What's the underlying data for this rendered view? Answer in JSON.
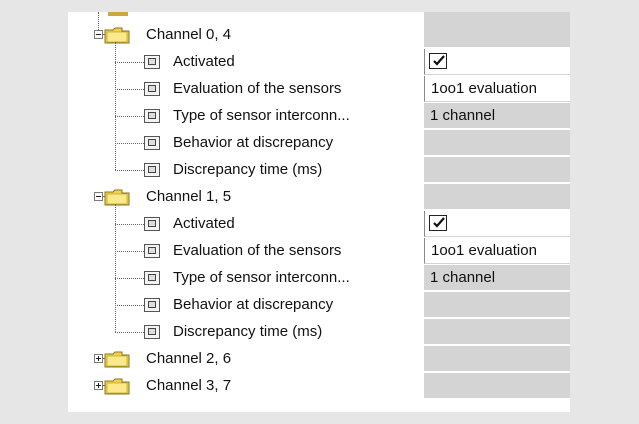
{
  "tree": {
    "channels": [
      {
        "label": "Channel 0, 4",
        "expanded": true,
        "params": [
          {
            "label": "Activated",
            "type": "checkbox",
            "checked": true
          },
          {
            "label": "Evaluation of the sensors",
            "type": "text",
            "value": "1oo1 evaluation"
          },
          {
            "label": "Type of sensor interconn...",
            "type": "text",
            "value": "1 channel"
          },
          {
            "label": "Behavior at discrepancy",
            "type": "empty"
          },
          {
            "label": "Discrepancy time (ms)",
            "type": "empty"
          }
        ]
      },
      {
        "label": "Channel 1, 5",
        "expanded": true,
        "params": [
          {
            "label": "Activated",
            "type": "checkbox",
            "checked": true
          },
          {
            "label": "Evaluation of the sensors",
            "type": "text",
            "value": "1oo1 evaluation"
          },
          {
            "label": "Type of sensor interconn...",
            "type": "text",
            "value": "1 channel"
          },
          {
            "label": "Behavior at discrepancy",
            "type": "empty"
          },
          {
            "label": "Discrepancy time (ms)",
            "type": "empty"
          }
        ]
      },
      {
        "label": "Channel 2, 6",
        "expanded": false,
        "params": []
      },
      {
        "label": "Channel 3, 7",
        "expanded": false,
        "params": []
      }
    ]
  },
  "colors": {
    "background": "#e6e6e6",
    "panel": "#ffffff",
    "disabled_cell": "#d4d4d4",
    "folder_yellow": "#f2d24a"
  },
  "icons": {
    "folder": "folder-icon",
    "parameter": "parameter-icon",
    "expand": "expand-icon",
    "collapse": "collapse-icon",
    "check": "checkmark-icon"
  }
}
